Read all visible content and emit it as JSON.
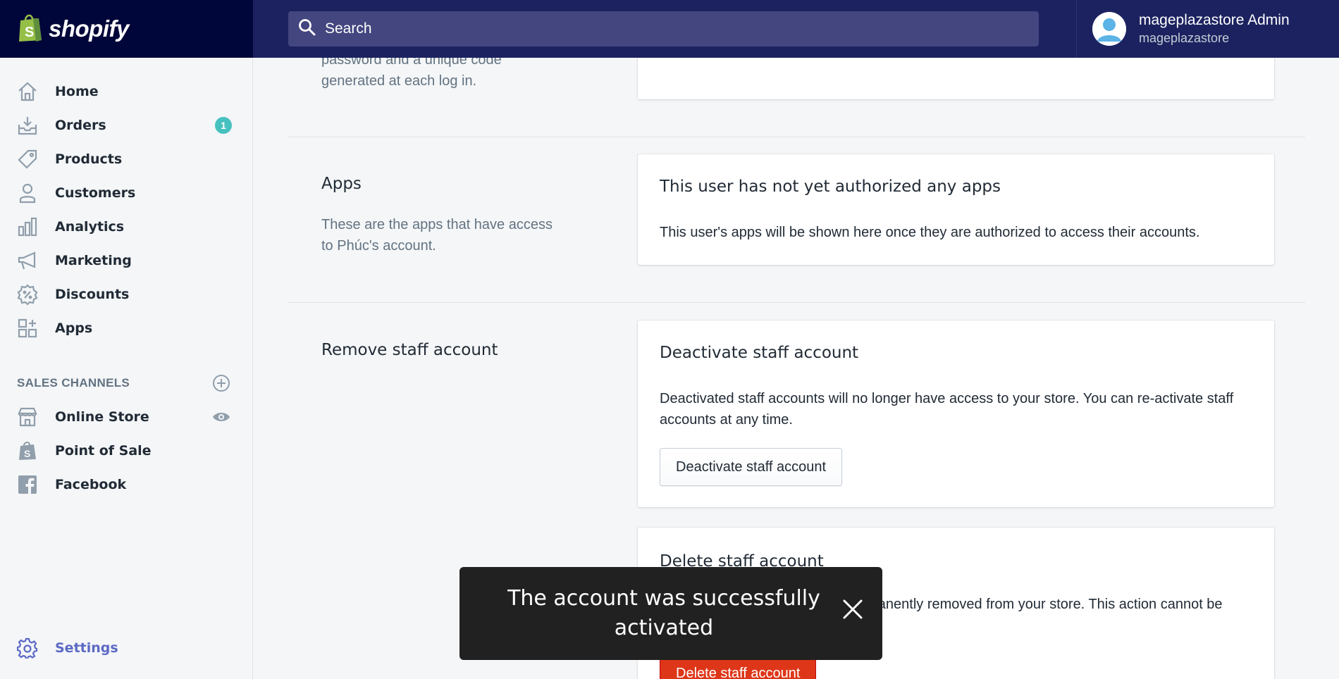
{
  "topbar": {
    "brand": "shopify",
    "search_placeholder": "Search",
    "account_name": "mageplazastore Admin",
    "account_store": "mageplazastore"
  },
  "sidebar": {
    "items": [
      {
        "label": "Home",
        "icon": "home-icon"
      },
      {
        "label": "Orders",
        "icon": "orders-icon",
        "badge": "1"
      },
      {
        "label": "Products",
        "icon": "tag-icon"
      },
      {
        "label": "Customers",
        "icon": "person-icon"
      },
      {
        "label": "Analytics",
        "icon": "bar-chart-icon"
      },
      {
        "label": "Marketing",
        "icon": "megaphone-icon"
      },
      {
        "label": "Discounts",
        "icon": "discount-icon"
      },
      {
        "label": "Apps",
        "icon": "apps-icon"
      }
    ],
    "channels_title": "SALES CHANNELS",
    "channels": [
      {
        "label": "Online Store",
        "icon": "store-icon"
      },
      {
        "label": "Point of Sale",
        "icon": "pos-bag-icon"
      },
      {
        "label": "Facebook",
        "icon": "facebook-icon"
      }
    ],
    "settings_label": "Settings"
  },
  "main": {
    "top_desc_line1": "password and a unique code",
    "top_desc_line2": "generated at each log in.",
    "apps_section": {
      "title": "Apps",
      "desc": "These are the apps that have access to Phúc's account.",
      "card_title": "This user has not yet authorized any apps",
      "card_text": "This user's apps will be shown here once they are authorized to access their accounts."
    },
    "remove_section": {
      "title": "Remove staff account",
      "deactivate_title": "Deactivate staff account",
      "deactivate_text": "Deactivated staff accounts will no longer have access to your store. You can re-activate staff accounts at any time.",
      "deactivate_button": "Deactivate staff account",
      "delete_title": "Delete staff account",
      "delete_text": "Deleted staff accounts will be permanently removed from your store. This action cannot be reversed.",
      "delete_button": "Delete staff account"
    }
  },
  "toast": {
    "message": "The account was successfully activated"
  },
  "colors": {
    "topbar": "#1c2260",
    "brand_bg": "#000639",
    "badge": "#47c1bf",
    "danger": "#de3618",
    "settings": "#5c6ac4"
  }
}
